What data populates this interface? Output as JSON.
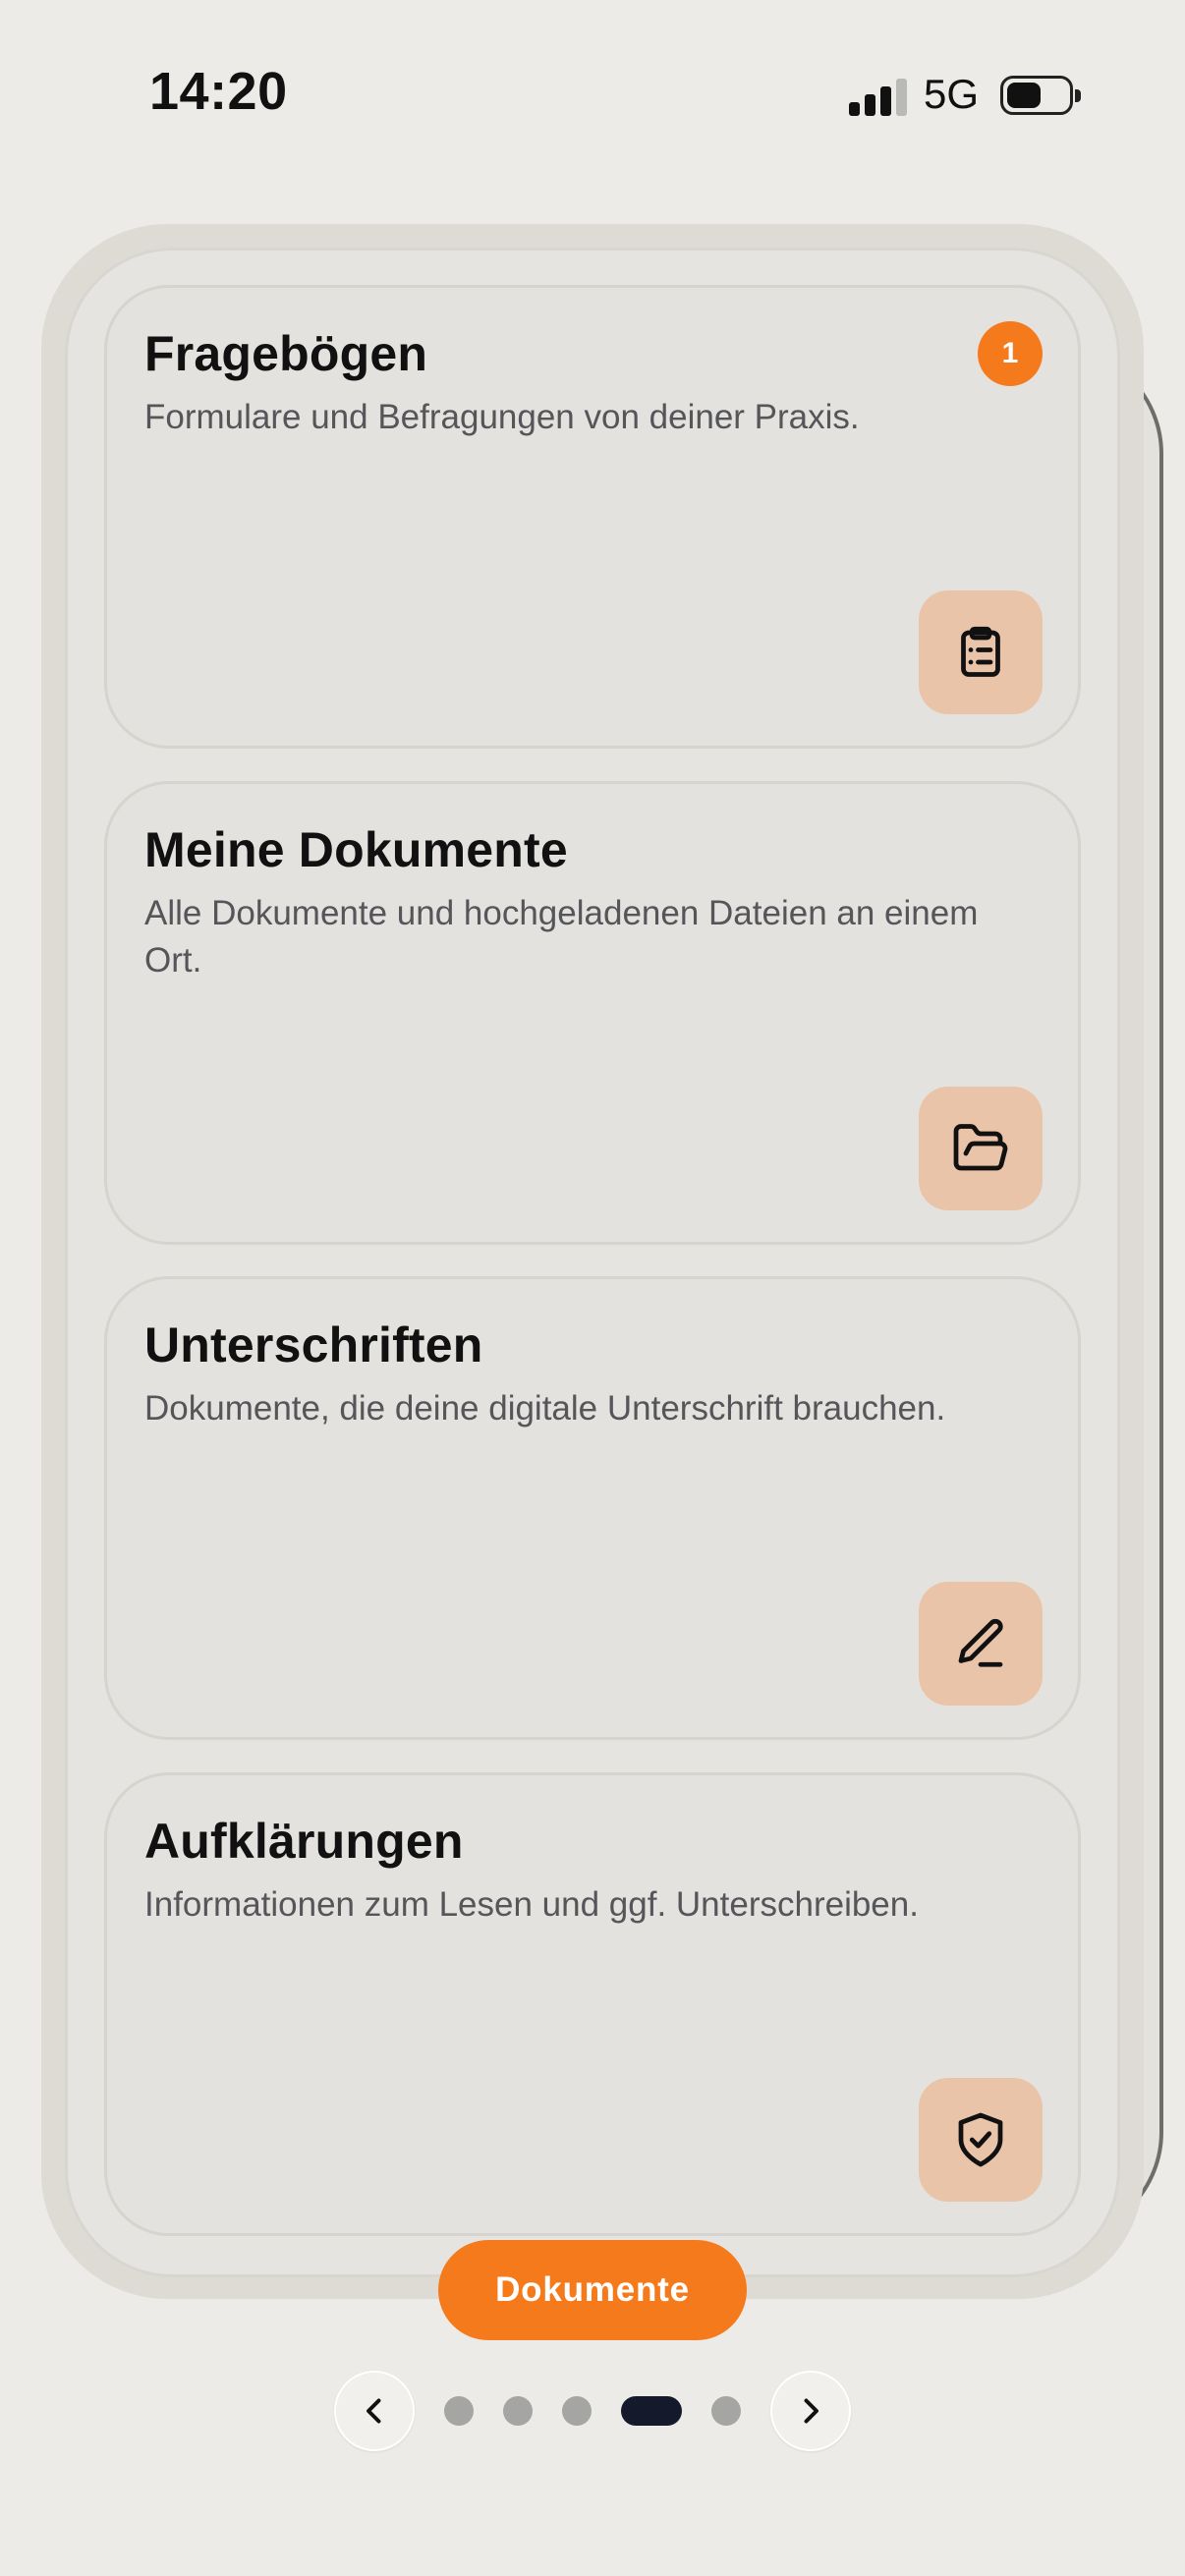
{
  "status_bar": {
    "time": "14:20",
    "network": "5G",
    "battery_level": 0.55
  },
  "cards": [
    {
      "title": "Fragebögen",
      "description": "Formulare und Befragungen von deiner Praxis.",
      "badge": "1",
      "icon": "clipboard-icon"
    },
    {
      "title": "Meine Dokumente",
      "description": "Alle Dokumente und hochgeladenen Dateien an einem Ort.",
      "icon": "folder-open-icon"
    },
    {
      "title": "Unterschriften",
      "description": "Dokumente, die deine digitale Unterschrift brauchen.",
      "icon": "pen-icon"
    },
    {
      "title": "Aufklärungen",
      "description": "Informationen zum Lesen und ggf. Unterschreiben.",
      "icon": "shield-check-icon"
    }
  ],
  "section_button": {
    "label": "Dokumente"
  },
  "pager": {
    "page_count": 5,
    "active_page": 4,
    "prev_icon": "chevron-left-icon",
    "next_icon": "chevron-right-icon"
  },
  "colors": {
    "accent": "#f47a1b",
    "icon_tile": "#eac4a8",
    "background": "#ecebe7",
    "active_dot": "#141a2b"
  }
}
